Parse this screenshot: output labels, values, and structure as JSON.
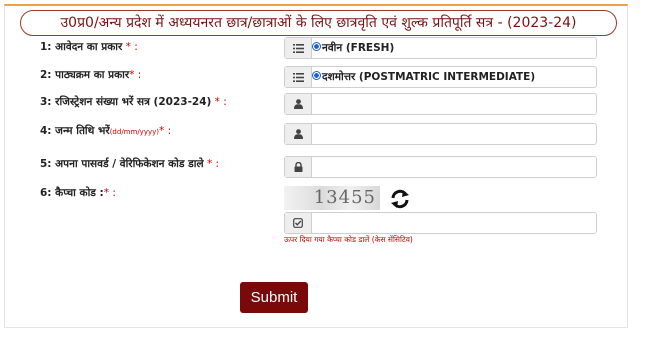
{
  "header": {
    "title": "उ0प्र0/अन्य प्रदेश में अध्ययनरत छात्र/छात्राओं के लिए छात्रवृति एवं शुल्क प्रतिपूर्ति सत्र - (2023-24)"
  },
  "form": {
    "application_type": {
      "label": "1: आवेदन का प्रकार",
      "required_mark": " * :",
      "icon": "list-icon",
      "value": "नवीन (FRESH)"
    },
    "course_type": {
      "label": "2: पाठ्यक्रम का प्रकार",
      "required_mark": "* :",
      "icon": "list-icon",
      "value": "दशमोत्तर (POSTMATRIC INTERMEDIATE)"
    },
    "registration_no": {
      "label": "3: रजिस्ट्रेशन संख्या भरें सत्र (2023-24)",
      "required_mark": " * :",
      "icon": "user-icon",
      "value": ""
    },
    "dob": {
      "label": "4: जन्म तिथि भरें",
      "format_hint": "(dd/mm/yyyy)",
      "required_mark": "* :",
      "icon": "user-icon",
      "value": ""
    },
    "password": {
      "label": "5: अपना पासवर्ड / वेरिफिकेशन कोड डाले",
      "required_mark": " * :",
      "icon": "lock-icon",
      "value": ""
    },
    "captcha": {
      "label": "6: कैप्चा कोड :",
      "required_mark": "* :",
      "code": "13455",
      "icon": "check-square-icon",
      "refresh_icon": "refresh-icon",
      "value": "",
      "hint": "ऊपर दिया गया कैप्चा कोड डालें (केस सेंसिटिव)"
    }
  },
  "submit_label": "Submit",
  "colors": {
    "header_text": "#7a1212",
    "required": "#cc0000",
    "submit_bg": "#7a0a0a",
    "radio": "#1a5fd6"
  }
}
